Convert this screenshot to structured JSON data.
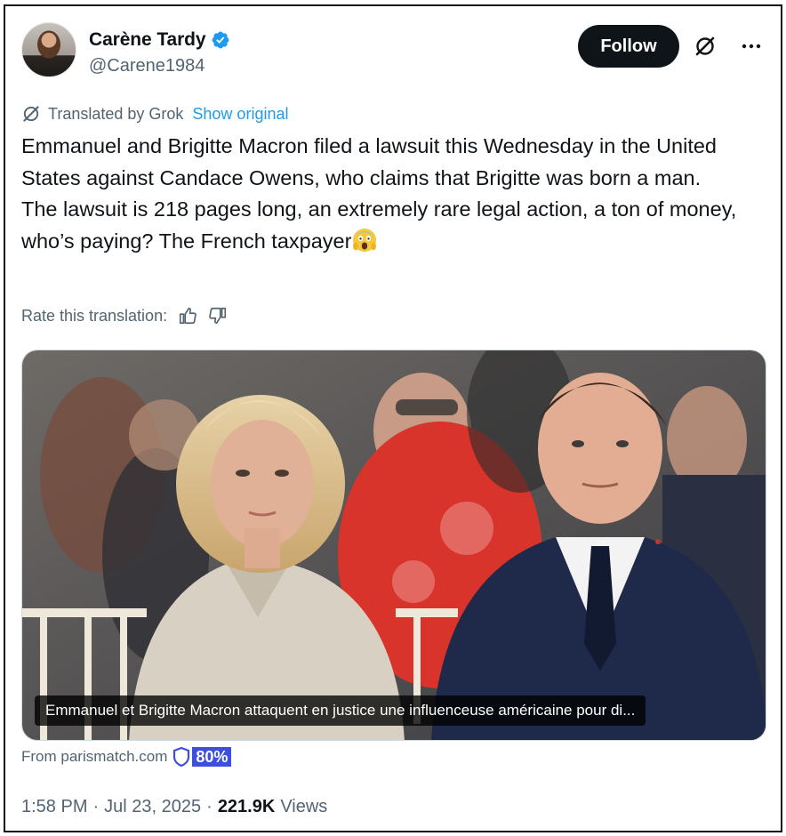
{
  "author": {
    "display_name": "Carène Tardy",
    "handle": "@Carene1984",
    "verified": true
  },
  "actions": {
    "follow_label": "Follow",
    "grok_icon": "grok-icon",
    "more_icon": "more-icon"
  },
  "translation": {
    "translated_by": "Translated by Grok",
    "show_original": "Show original",
    "rate_label": "Rate this translation:"
  },
  "tweet": {
    "paragraph_1": "Emmanuel and Brigitte Macron filed a lawsuit this Wednesday in the United States against Candace Owens, who claims that Brigitte was born a man.",
    "paragraph_2": "The lawsuit is 218 pages long, an extremely rare legal action, a ton of money, who’s paying? The French taxpayer",
    "emoji": "face-screaming-in-fear"
  },
  "media": {
    "caption": "Emmanuel et Brigitte Macron attaquent en justice une influenceuse américaine pour di..."
  },
  "source": {
    "label": "From parismatch.com",
    "score": "80%"
  },
  "meta": {
    "time": "1:58 PM",
    "separator": "·",
    "date": "Jul 23, 2025",
    "views_count": "221.9K",
    "views_label": "Views"
  },
  "colors": {
    "link": "#1d9bf0",
    "secondary_text": "#536471",
    "primary_text": "#0f1419",
    "score_badge": "#3c4fe0",
    "verified": "#1d9bf0"
  }
}
